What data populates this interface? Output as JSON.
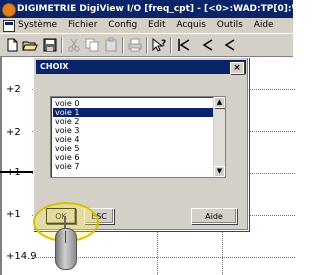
{
  "window": {
    "title": "DIGIMETRIE DigiView I/O [freq_cpt] - [<0>:WAD:TP[0]:WIN",
    "title_color": "#0a246a"
  },
  "menu": {
    "items": [
      "Système",
      "Fichier",
      "Config",
      "Edit",
      "Acquis",
      "Outils",
      "Aide"
    ]
  },
  "toolbar": {
    "icons": [
      "new-document-icon",
      "open-folder-icon",
      "save-icon",
      "cut-icon",
      "copy-icon",
      "paste-icon",
      "print-icon",
      "help-pointer-icon",
      "first-icon",
      "previous-icon",
      "back-icon"
    ]
  },
  "plot": {
    "y_labels": [
      "+2",
      "+2",
      "+1",
      "+1",
      "+14.9"
    ]
  },
  "dialog": {
    "title": "CHOIX",
    "close": "×",
    "list": {
      "items": [
        "voie 0",
        "voie 1",
        "voie 2",
        "voie 3",
        "voie 4",
        "voie 5",
        "voie 6",
        "voie 7"
      ],
      "selected": "voie 1"
    },
    "buttons": {
      "ok": "OK",
      "esc": "ESC",
      "aide": "Aide"
    }
  }
}
